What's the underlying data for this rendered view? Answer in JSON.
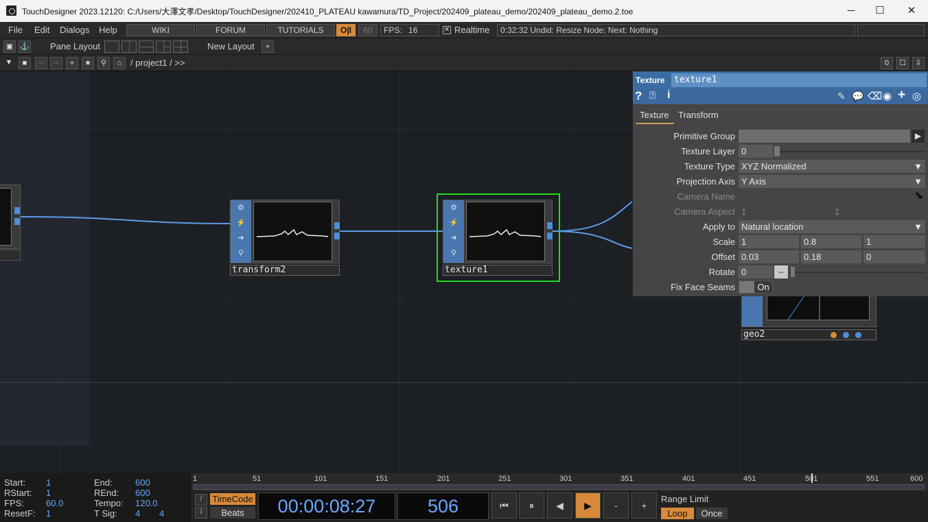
{
  "window": {
    "title": "TouchDesigner 2023.12120: C:/Users/大澤文孝/Desktop/TouchDesigner/202410_PLATEAU kawamura/TD_Project/202409_plateau_demo/202409_plateau_demo.2.toe",
    "minimize": "─",
    "maximize": "☐",
    "close": "✕"
  },
  "menubar": {
    "file": "File",
    "edit": "Edit",
    "dialogs": "Dialogs",
    "help": "Help",
    "wiki": "WIKI",
    "forum": "FORUM",
    "tutorials": "TUTORIALS",
    "oi": "O|I",
    "fps_cap": "60",
    "fps_label": "FPS:",
    "fps_value": "16",
    "realtime_check": "✕",
    "realtime": "Realtime",
    "status": "0:32:32 Undid: Resize Node; Next: Nothing"
  },
  "toolbar": {
    "pane_layout": "Pane Layout",
    "new_layout": "New Layout",
    "plus": "+",
    "path": "/ project1 / >>",
    "pane_index": "0"
  },
  "nodes": {
    "transform2": "transform2",
    "texture1": "texture1",
    "geo2": "geo2"
  },
  "params": {
    "op_type": "Texture",
    "op_name": "texture1",
    "tabs": [
      "Texture",
      "Transform"
    ],
    "primitive_group_label": "Primitive Group",
    "texture_layer_label": "Texture Layer",
    "texture_layer_value": "0",
    "texture_type_label": "Texture Type",
    "texture_type_value": "XYZ Normalized",
    "projection_axis_label": "Projection Axis",
    "projection_axis_value": "Y Axis",
    "camera_name_label": "Camera Name",
    "camera_aspect_label": "Camera Aspect",
    "camera_aspect_1": "1",
    "camera_aspect_2": "1",
    "apply_to_label": "Apply to",
    "apply_to_value": "Natural location",
    "scale_label": "Scale",
    "scale": [
      "1",
      "0.8",
      "1"
    ],
    "offset_label": "Offset",
    "offset": [
      "0.03",
      "0.18",
      "0"
    ],
    "rotate_label": "Rotate",
    "rotate_value": "0",
    "fix_face_seams_label": "Fix Face Seams",
    "fix_face_seams_value": "On"
  },
  "timeline": {
    "start_label": "Start:",
    "start": "1",
    "end_label": "End:",
    "end": "600",
    "rstart_label": "RStart:",
    "rstart": "1",
    "rend_label": "REnd:",
    "rend": "600",
    "fps_label": "FPS:",
    "fps": "60.0",
    "tempo_label": "Tempo:",
    "tempo": "120.0",
    "resetf_label": "ResetF:",
    "resetf": "1",
    "tsig_label": "T Sig:",
    "tsig_a": "4",
    "tsig_b": "4",
    "ticks": [
      "1",
      "51",
      "101",
      "151",
      "201",
      "251",
      "301",
      "351",
      "401",
      "451",
      "501",
      "551",
      "600"
    ],
    "timecode_btn": "TimeCode",
    "beats_btn": "Beats",
    "slash_btn": "/",
    "bar_btn": "I",
    "timecode": "00:00:08:27",
    "frame": "506",
    "range_limit": "Range Limit",
    "loop": "Loop",
    "once": "Once",
    "rewind": "⏮",
    "pause": "⏸",
    "step_back": "◀",
    "play": "▶",
    "minus": "-",
    "plus": "+"
  }
}
